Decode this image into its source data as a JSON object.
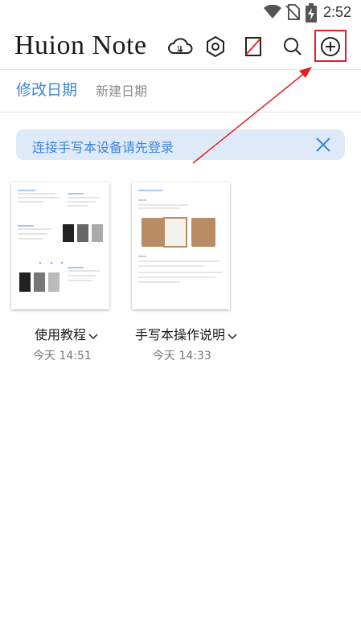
{
  "status_bar": {
    "time": "2:52"
  },
  "header": {
    "app_title": "Huion Note",
    "icons": [
      "cloud-sync-icon",
      "settings-hexagon-icon",
      "disconnected-device-icon",
      "search-icon",
      "add-note-icon"
    ]
  },
  "sort_tabs": {
    "modified_date": "修改日期",
    "created_date": "新建日期"
  },
  "banner": {
    "text": "连接手写本设备请先登录"
  },
  "notes": [
    {
      "title": "使用教程",
      "time": "今天 14:51"
    },
    {
      "title": "手写本操作说明",
      "time": "今天 14:33"
    }
  ],
  "colors": {
    "accent": "#3a86d9",
    "banner_bg": "#dfeaf9",
    "highlight": "#e31e24"
  }
}
